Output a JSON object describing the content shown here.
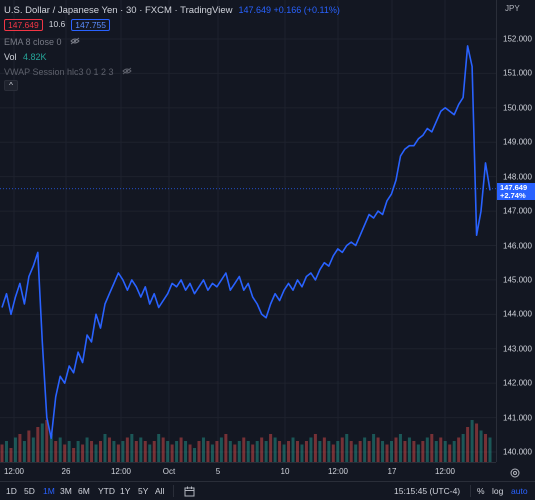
{
  "legend": {
    "symbol_title": "U.S. Dollar / Japanese Yen · 30 · FXCM · TradingView",
    "sell_price": "147.649",
    "spread": "10.6",
    "buy_price": "147.755",
    "price_readout": "147.649 +0.166 (+0.11%)",
    "ema_label": "EMA 8 close 0",
    "vol_label": "Vol",
    "vol_value": "4.82K",
    "vwap_label": "VWAP Session hlc3 0 1 2 3",
    "collapse_glyph": "^"
  },
  "price_scale": {
    "currency": "JPY",
    "ticks": [
      "152.000",
      "151.000",
      "150.000",
      "149.000",
      "148.000",
      "147.000",
      "146.000",
      "145.000",
      "144.000",
      "143.000",
      "142.000",
      "141.000",
      "140.000"
    ],
    "current_price": "147.649",
    "current_change": "+2.74%"
  },
  "time_scale": {
    "ticks": [
      "12:00",
      "26",
      "12:00",
      "Oct",
      "5",
      "10",
      "12:00",
      "17",
      "12:00"
    ]
  },
  "toolbar": {
    "timeframes": [
      "1D",
      "5D",
      "1M",
      "3M",
      "6M",
      "YTD",
      "1Y",
      "5Y",
      "All"
    ],
    "active_timeframe": "1M",
    "clock": "15:15:45 (UTC-4)",
    "percent": "%",
    "log": "log",
    "auto": "auto"
  },
  "colors": {
    "background": "#131722",
    "line": "#2962ff",
    "volume_up": "#26a69a",
    "volume_down": "#ef5350",
    "accent": "#2962ff"
  },
  "icons": {
    "eye": "eye-icon",
    "settings": "settings-icon",
    "calendar": "calendar-range-icon"
  },
  "chart_data": {
    "type": "line",
    "ylim": [
      139.7,
      152.3
    ],
    "series": [
      {
        "values": [
          144.2,
          144.6,
          144.0,
          144.5,
          144.9,
          144.3,
          145.1,
          145.4,
          145.8,
          143.2,
          141.0,
          140.4,
          141.6,
          142.2,
          142.0,
          142.5,
          142.3,
          142.9,
          142.6,
          143.4,
          143.2,
          144.0,
          143.6,
          144.3,
          144.6,
          144.9,
          145.2,
          145.0,
          144.7,
          145.0,
          144.8,
          144.5,
          144.8,
          144.3,
          144.6,
          144.2,
          144.4,
          144.6,
          144.9,
          144.8,
          145.0,
          144.7,
          144.9,
          144.6,
          144.8,
          145.0,
          144.7,
          144.9,
          144.8,
          145.0,
          145.2,
          144.7,
          144.9,
          145.1,
          144.7,
          144.9,
          144.5,
          144.3,
          144.0,
          143.9,
          144.3,
          144.6,
          144.4,
          144.7,
          144.9,
          144.7,
          145.0,
          144.8,
          145.1,
          145.2,
          145.0,
          145.3,
          145.5,
          145.4,
          145.7,
          145.9,
          145.8,
          146.0,
          146.1,
          146.0,
          146.3,
          146.6,
          146.9,
          146.8,
          147.0,
          146.9,
          147.3,
          147.5,
          147.9,
          148.6,
          148.8,
          148.9,
          148.9,
          149.1,
          149.2,
          149.4,
          149.3,
          149.6,
          149.9,
          150.0,
          149.9,
          149.8,
          150.1,
          150.3,
          151.8,
          151.2,
          146.3,
          147.0,
          148.4,
          147.6
        ]
      }
    ],
    "volume": {
      "values": [
        0.25,
        0.3,
        0.2,
        0.35,
        0.4,
        0.3,
        0.45,
        0.35,
        0.5,
        0.55,
        0.6,
        0.4,
        0.3,
        0.35,
        0.25,
        0.3,
        0.2,
        0.3,
        0.25,
        0.35,
        0.3,
        0.25,
        0.3,
        0.4,
        0.35,
        0.3,
        0.25,
        0.3,
        0.35,
        0.4,
        0.3,
        0.35,
        0.3,
        0.25,
        0.3,
        0.4,
        0.35,
        0.3,
        0.25,
        0.3,
        0.35,
        0.3,
        0.25,
        0.2,
        0.3,
        0.35,
        0.3,
        0.25,
        0.3,
        0.35,
        0.4,
        0.3,
        0.25,
        0.3,
        0.35,
        0.3,
        0.25,
        0.3,
        0.35,
        0.3,
        0.4,
        0.35,
        0.3,
        0.25,
        0.3,
        0.35,
        0.3,
        0.25,
        0.3,
        0.35,
        0.4,
        0.3,
        0.35,
        0.3,
        0.25,
        0.3,
        0.35,
        0.4,
        0.3,
        0.25,
        0.3,
        0.35,
        0.3,
        0.4,
        0.35,
        0.3,
        0.25,
        0.3,
        0.35,
        0.4,
        0.3,
        0.35,
        0.3,
        0.25,
        0.3,
        0.35,
        0.4,
        0.3,
        0.35,
        0.3,
        0.25,
        0.3,
        0.35,
        0.4,
        0.5,
        0.6,
        0.55,
        0.45,
        0.4,
        0.35
      ],
      "max_label": "4.82K"
    }
  }
}
